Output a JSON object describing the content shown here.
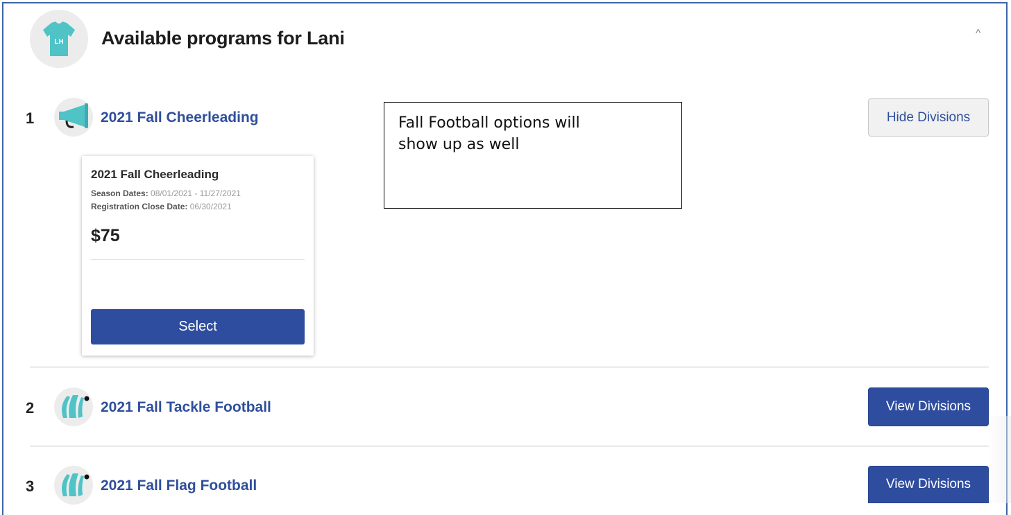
{
  "header": {
    "title": "Available programs for Lani",
    "avatar_initials": "LH",
    "avatar_color": "#4fc3c6",
    "collapse_icon": "chevron-up-icon"
  },
  "programs": [
    {
      "number": "1",
      "name": "2021 Fall Cheerleading",
      "icon": "megaphone-icon",
      "button": "Hide Divisions"
    },
    {
      "number": "2",
      "name": "2021 Fall Tackle Football",
      "icon": "football-icon",
      "button": "View Divisions"
    },
    {
      "number": "3",
      "name": "2021 Fall Flag Football",
      "icon": "football-icon",
      "button": "View Divisions"
    }
  ],
  "division_card": {
    "title": "2021 Fall Cheerleading",
    "season_label": "Season Dates:",
    "season_value": "08/01/2021 - 11/27/2021",
    "close_label": "Registration Close Date:",
    "close_value": "06/30/2021",
    "price": "$75",
    "select_label": "Select"
  },
  "annotation": {
    "line1": "Fall Football options will",
    "line2": "show up as well"
  },
  "colors": {
    "accent": "#2f4d9e",
    "link": "#2f4f9c",
    "icon_teal": "#4fc3c6",
    "frame_border": "#3e64a8"
  }
}
